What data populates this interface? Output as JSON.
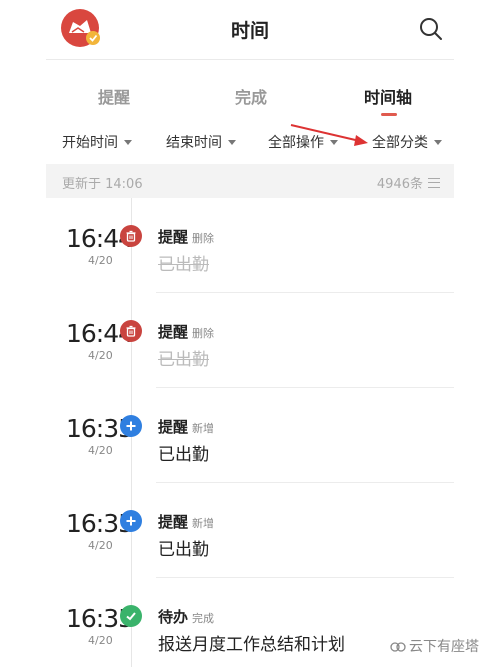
{
  "header": {
    "title": "时间",
    "avatar_icon": "app-logo-icon",
    "search_icon": "search-icon"
  },
  "tabs": [
    {
      "label": "提醒",
      "active": false
    },
    {
      "label": "完成",
      "active": false
    },
    {
      "label": "时间轴",
      "active": true
    }
  ],
  "filters": [
    {
      "label": "开始时间"
    },
    {
      "label": "结束时间"
    },
    {
      "label": "全部操作"
    },
    {
      "label": "全部分类"
    }
  ],
  "status": {
    "updated": "更新于 14:06",
    "count": "4946条"
  },
  "entries": [
    {
      "time": "16:44",
      "date": "4/20",
      "type": "提醒",
      "action": "删除",
      "text": "已出勤",
      "status": "delete",
      "icon": "trash-icon"
    },
    {
      "time": "16:44",
      "date": "4/20",
      "type": "提醒",
      "action": "删除",
      "text": "已出勤",
      "status": "delete",
      "icon": "trash-icon"
    },
    {
      "time": "16:35",
      "date": "4/20",
      "type": "提醒",
      "action": "新增",
      "text": "已出勤",
      "status": "add",
      "icon": "plus-icon"
    },
    {
      "time": "16:35",
      "date": "4/20",
      "type": "提醒",
      "action": "新增",
      "text": "已出勤",
      "status": "add",
      "icon": "plus-icon"
    },
    {
      "time": "16:35",
      "date": "4/20",
      "type": "待办",
      "action": "完成",
      "text": "报送月度工作总结和计划",
      "status": "done",
      "icon": "check-icon"
    }
  ],
  "watermark": "云下有座塔",
  "colors": {
    "accent": "#e05a4e",
    "delete": "#c9443f",
    "add": "#2f7fe0",
    "done": "#3ab36b"
  }
}
